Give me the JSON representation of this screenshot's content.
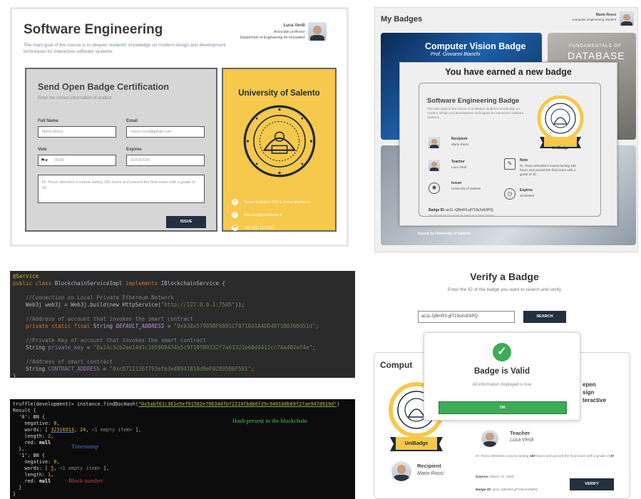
{
  "send_panel": {
    "title": "Software Engineering",
    "description": "The main goal of the course is to deepen students' knowledge on modern design and development techniques for interactive software systems.",
    "user": {
      "name": "Luca Verdi",
      "role": "Associate professor",
      "department": "Department of Engineering for Innovation"
    },
    "form": {
      "title": "Send Open Badge Certification",
      "subtitle": "Enter the correct information of student",
      "full_name_label": "Full Name",
      "full_name_value": "Mario Rossi",
      "email_label": "Email",
      "email_value": "mario.rossi@gmail.com",
      "vote_label": "Vote",
      "vote_value": "30/30",
      "expires_label": "Expires",
      "expires_value": "31/03/2025",
      "note_value": "Dr. Rossi attended a course lasting 150 hours and passed the final exam with a grade of 30",
      "issue_label": "ISSUE"
    },
    "university": {
      "name": "University of Salento",
      "address": "Centro Ecotekne, S.P. 6, Lecce Monteroni",
      "email": "luca.verdi@unisalento.it",
      "phone": "+39 0832 123 4567"
    }
  },
  "badges_panel": {
    "title": "My Badges",
    "user": {
      "name": "Mario Rossi",
      "department": "Computer Engineering Student"
    },
    "card_cv": {
      "title": "Computer Vision Badge",
      "professor": "Prof. Giovanni Bianchi"
    },
    "card_db": {
      "line1": "FUNDAMENTALS OF",
      "line2": "DATABASE"
    },
    "earned": {
      "title": "You have earned a new badge",
      "badge_title": "Software Engineering Badge",
      "badge_description": "The main goal of the course is to deepen students' knowledge on modern design and development techniques for interactive software systems.",
      "recipient_label": "Recipient",
      "recipient_value": "Mario Rossi",
      "teacher_label": "Teacher",
      "teacher_value": "Luca Verdi",
      "note_label": "Note",
      "note_value": "Dr. Rossi attended a course lasting 150 hours and passed the final exam with a grade of 30",
      "issuer_label": "Issuer",
      "issuer_value": "University of Salento",
      "expires_label": "Expires",
      "expires_value": "31/3/2025",
      "badge_id_label": "Badge ID:",
      "badge_id_value": "ac1L-Q8mR3-gf719uXsE6PQ",
      "share_text": "You can use the ID to share the badge on a Social Platform",
      "medal_label": "UniBadge"
    },
    "issued_by": "Issued by University of Salento"
  },
  "code_panel": {
    "annotation": "@Service",
    "class_decl_1": "public class ",
    "class_name": "BlockchainServiceImpl",
    "class_decl_2": " implements ",
    "iface_name": "IBlockchainService",
    "class_decl_3": " {",
    "comment1": "//Connection on Local Private Ethereum Network",
    "web3_line_a": "Web3j web3j = Web3j.",
    "web3_build": "build",
    "web3_line_b": "(new HttpService(",
    "web3_url": "\"http://127.0.0.1:7545\"",
    "web3_line_c": "));",
    "comment2": "//Address of account that invokes the smart contract",
    "addr_mod": "private static final ",
    "addr_type": "String ",
    "addr_name": "DEFAULT_ADDRESS",
    "addr_eq": " = ",
    "addr_val": "\"0x038a579898F6891CF871041A4DD48f180360d51d\"",
    "end_semicolon": ";",
    "comment3": "//Private Key of account that invokes the smart contract",
    "pk_type": "String ",
    "pk_name": "private_key",
    "pk_eq": " = ",
    "pk_val": "\"0x24c3cb2ae14d1c165909434b5c9f10f89332f7a63321e68d4411cc74a402ef4e\"",
    "comment4": "//Address of smart contract",
    "ca_type": "String ",
    "ca_name": "CONTRACT_ADDRESS",
    "ca_eq": " = ",
    "ca_val": "\"0xcD711136f793efe3e48941810d9eF0289586F581\"",
    "closing_brace": "}"
  },
  "terminal_panel": {
    "prompt": "truffle(development)> instance.findDocHash(",
    "hash_arg": "\"0x5abf61c361e5ef91582e70634dfbf2214fbdb6f29c949160b69f27ae947d919d\"",
    "prompt_end": ")",
    "result_label": "Result {",
    "block0_head": "  '0': BN {",
    "negative_label": "    negative: ",
    "negative_value": "0",
    "words_label": "    words: [ ",
    "words0_a": "32316913",
    "words0_b": "24",
    "empty_item": "<1 empty item>",
    "words_end": " ],",
    "length_label": "    length: ",
    "length0": "2",
    "red_label": "    red: ",
    "red_value": "null",
    "block_close": "  },",
    "block1_head": "  '1': BN {",
    "words1_a": "5",
    "length1": "1",
    "block_close_last": "  }",
    "result_close": "}",
    "note_hash": "Hash present in the blockchain",
    "note_timestamp": "Timestamp",
    "note_block": "Block number"
  },
  "verify_panel": {
    "title": "Verify a Badge",
    "subtitle": "Enter the ID of the badge you want to search and verify",
    "input_value": "ac1L-Q8mR3-gf719uXsE6PQ",
    "search_label": "SEARCH",
    "card": {
      "title": "Comput",
      "desc_line1": "epen",
      "desc_line2": "sign",
      "desc_line3": "teractive",
      "medal_label": "UniBadge",
      "teacher_label": "Teacher",
      "teacher_value": "Luca Verdi",
      "note_prefix": "Dr. Rossi attended a course lasting ",
      "note_hours": "150",
      "note_mid": " hours and passed the final exam with a grade of ",
      "note_grade": "30",
      "recipient_label": "Recipient",
      "recipient_value": "Mario Rossi",
      "expires_label": "Expires:",
      "expires_value": "March 31, 2025",
      "badge_id_label": "Badge ID:",
      "badge_id_value": "ac1L-Q8mR3-gf719uXsE6PQ",
      "verify_label": "VERIFY"
    },
    "modal": {
      "title": "Badge is Valid",
      "subtitle": "All information displayed is true",
      "ok_label": "OK"
    }
  },
  "colors": {
    "navy_button": "#22303f",
    "university_yellow": "#f6c84b",
    "valid_green": "#3eab56"
  }
}
